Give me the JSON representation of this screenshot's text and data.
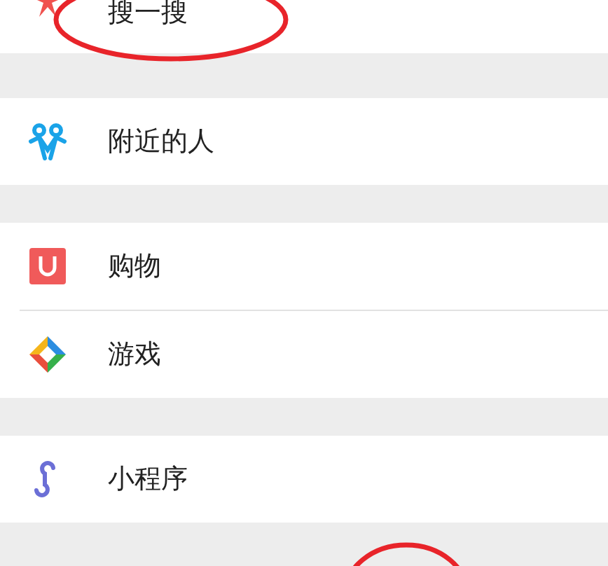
{
  "sections": [
    {
      "items": [
        {
          "label": "搜一搜",
          "kind": "search"
        }
      ]
    },
    {
      "items": [
        {
          "label": "附近的人",
          "kind": "nearby"
        }
      ]
    },
    {
      "items": [
        {
          "label": "购物",
          "kind": "shop"
        },
        {
          "label": "游戏",
          "kind": "games"
        }
      ]
    },
    {
      "items": [
        {
          "label": "小程序",
          "kind": "miniprogram"
        }
      ]
    }
  ]
}
